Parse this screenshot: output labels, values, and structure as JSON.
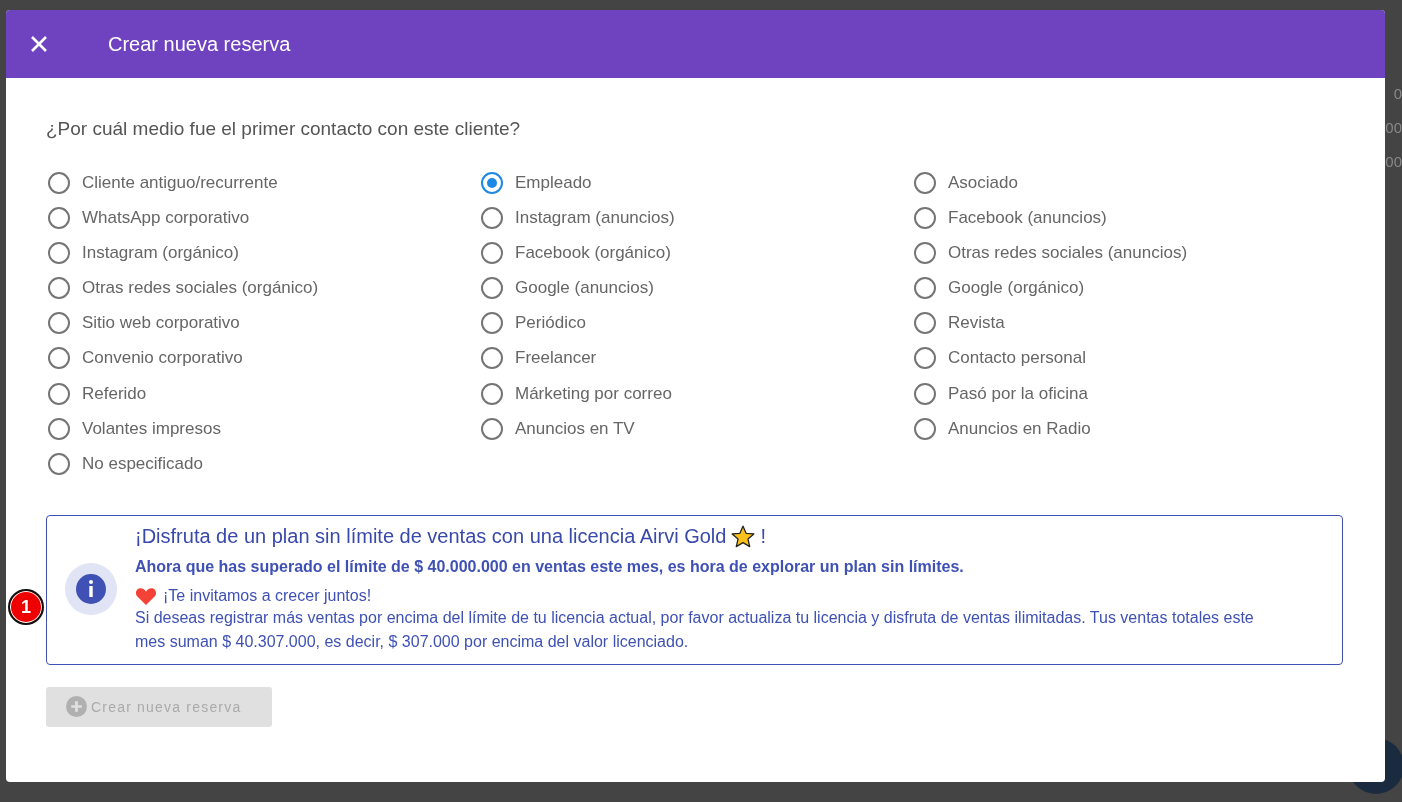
{
  "backdrop": {
    "cells": [
      "0",
      "00",
      "00"
    ]
  },
  "dialog": {
    "title": "Crear nueva reserva",
    "question": "¿Por cuál medio fue el primer contacto con este cliente?",
    "option_columns": [
      [
        {
          "label": "Cliente antiguo/recurrente",
          "selected": false
        },
        {
          "label": "WhatsApp corporativo",
          "selected": false
        },
        {
          "label": "Instagram (orgánico)",
          "selected": false
        },
        {
          "label": "Otras redes sociales (orgánico)",
          "selected": false
        },
        {
          "label": "Sitio web corporativo",
          "selected": false
        },
        {
          "label": "Convenio corporativo",
          "selected": false
        },
        {
          "label": "Referido",
          "selected": false
        },
        {
          "label": "Volantes impresos",
          "selected": false
        },
        {
          "label": "No especificado",
          "selected": false
        }
      ],
      [
        {
          "label": "Empleado",
          "selected": true
        },
        {
          "label": "Instagram (anuncios)",
          "selected": false
        },
        {
          "label": "Facebook (orgánico)",
          "selected": false
        },
        {
          "label": "Google (anuncios)",
          "selected": false
        },
        {
          "label": "Periódico",
          "selected": false
        },
        {
          "label": "Freelancer",
          "selected": false
        },
        {
          "label": "Márketing por correo",
          "selected": false
        },
        {
          "label": "Anuncios en TV",
          "selected": false
        }
      ],
      [
        {
          "label": "Asociado",
          "selected": false
        },
        {
          "label": "Facebook (anuncios)",
          "selected": false
        },
        {
          "label": "Otras redes sociales (anuncios)",
          "selected": false
        },
        {
          "label": "Google (orgánico)",
          "selected": false
        },
        {
          "label": "Revista",
          "selected": false
        },
        {
          "label": "Contacto personal",
          "selected": false
        },
        {
          "label": "Pasó por la oficina",
          "selected": false
        },
        {
          "label": "Anuncios en Radio",
          "selected": false
        }
      ]
    ],
    "banner": {
      "badge": "1",
      "title": "¡Disfruta de un plan sin límite de ventas con una licencia Airvi Gold",
      "title_end": "!",
      "subtitle": "Ahora que has superado el límite de $ 40.000.000 en ventas este mes, es hora de explorar un plan sin límites.",
      "invite": "¡Te invitamos a crecer juntos!",
      "body": "Si deseas registrar más ventas por encima del límite de tu licencia actual, por favor actualiza tu licencia y disfruta de ventas ilimitadas. Tus ventas totales este mes suman $ 40.307.000, es decir, $ 307.000 por encima del valor licenciado."
    },
    "submit": {
      "label": "Crear nueva reserva",
      "disabled": true
    }
  }
}
